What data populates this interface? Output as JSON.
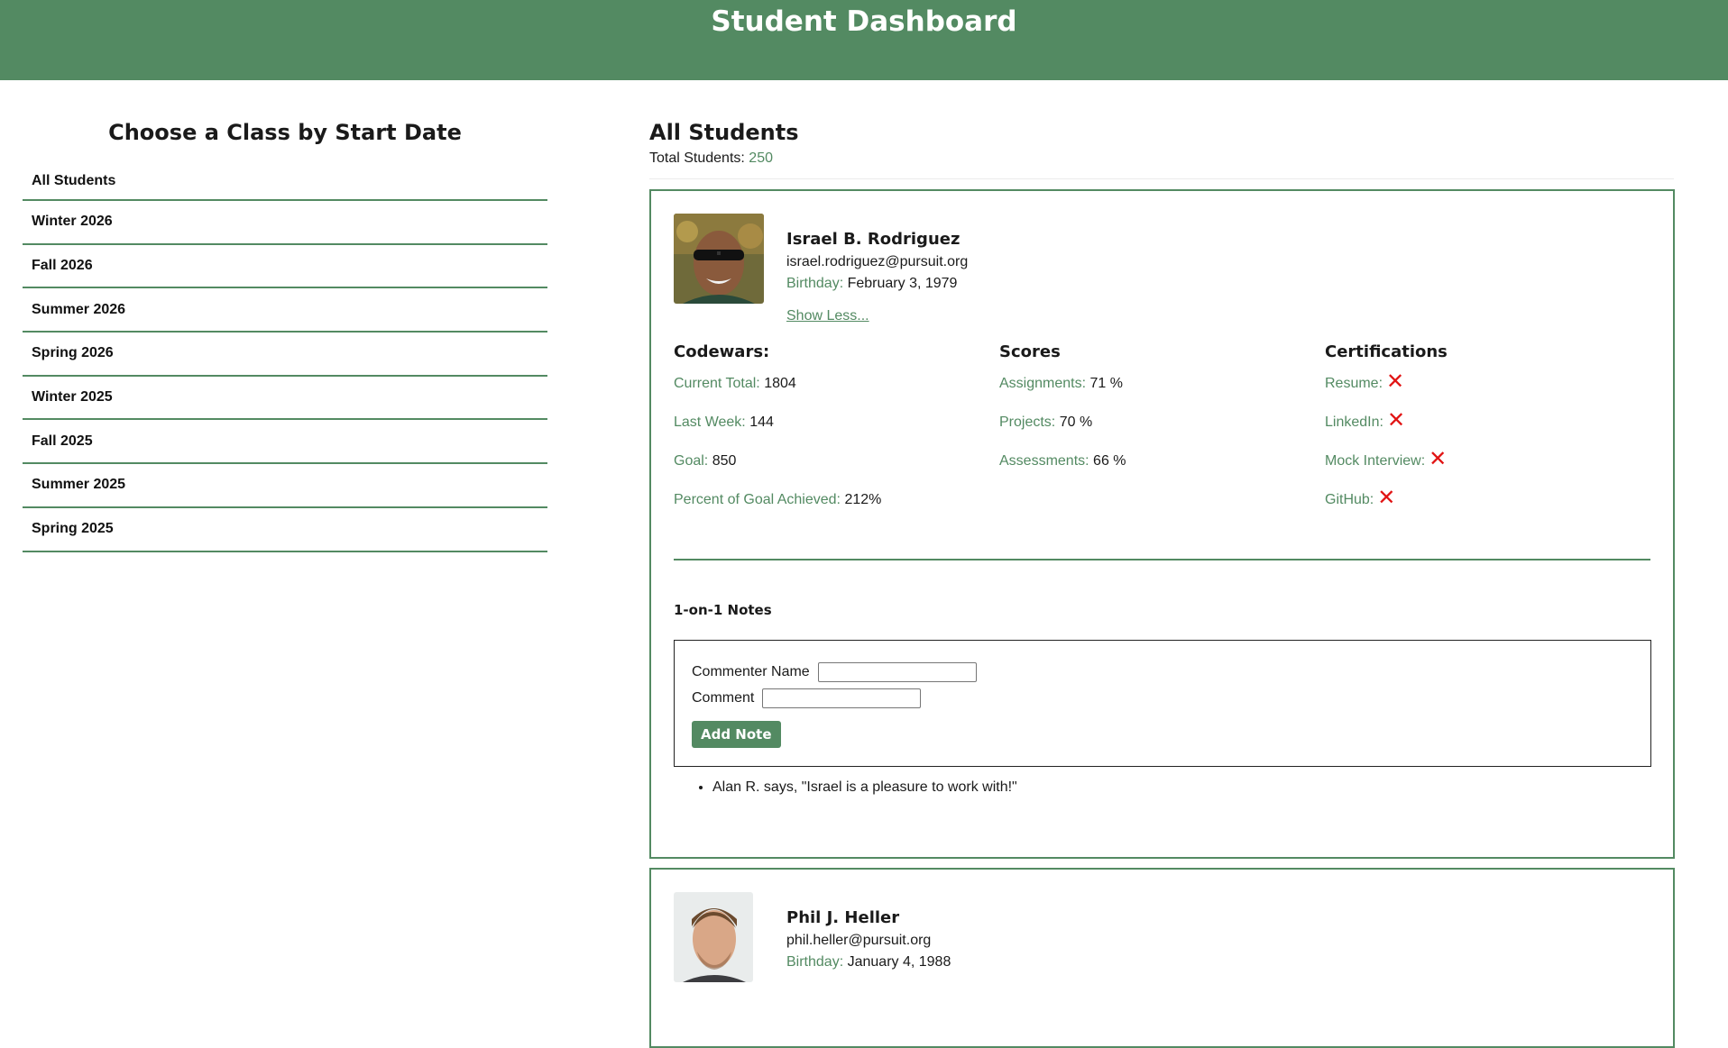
{
  "header": {
    "title": "Student Dashboard"
  },
  "sidebar": {
    "title": "Choose a Class by Start Date",
    "items": [
      {
        "label": "All Students"
      },
      {
        "label": "Winter 2026"
      },
      {
        "label": "Fall 2026"
      },
      {
        "label": "Summer 2026"
      },
      {
        "label": "Spring 2026"
      },
      {
        "label": "Winter 2025"
      },
      {
        "label": "Fall 2025"
      },
      {
        "label": "Summer 2025"
      },
      {
        "label": "Spring 2025"
      }
    ]
  },
  "main": {
    "title": "All Students",
    "total_label": "Total Students: ",
    "total_count": "250"
  },
  "students": [
    {
      "name": "Israel B. Rodriguez",
      "email": "israel.rodriguez@pursuit.org",
      "birthday_label": "Birthday: ",
      "birthday": "February 3, 1979",
      "show_less": "Show Less...",
      "codewars": {
        "title": "Codewars:",
        "current_total_label": "Current Total: ",
        "current_total": "1804",
        "last_week_label": "Last Week: ",
        "last_week": "144",
        "goal_label": "Goal: ",
        "goal": "850",
        "percent_label": "Percent of Goal Achieved: ",
        "percent": "212%"
      },
      "scores": {
        "title": "Scores",
        "assignments_label": "Assignments: ",
        "assignments": "71 %",
        "projects_label": "Projects: ",
        "projects": "70 %",
        "assessments_label": "Assessments: ",
        "assessments": "66 %"
      },
      "certifications": {
        "title": "Certifications",
        "resume_label": "Resume:",
        "linkedin_label": "LinkedIn:",
        "mock_interview_label": "Mock Interview:",
        "github_label": "GitHub:",
        "status_mark": "✕"
      },
      "notes": {
        "title": "1-on-1 Notes",
        "commenter_label": "Commenter Name",
        "commenter_value": "",
        "comment_label": "Comment",
        "comment_value": "",
        "add_button": "Add Note",
        "comments": [
          "Alan R. says, \"Israel is a pleasure to work with!\""
        ]
      }
    },
    {
      "name": "Phil J. Heller",
      "email": "phil.heller@pursuit.org",
      "birthday_label": "Birthday: ",
      "birthday": "January 4, 1988"
    }
  ],
  "colors": {
    "accent": "#538a62",
    "header_bg": "#538a62",
    "x_mark": "#e11414"
  }
}
